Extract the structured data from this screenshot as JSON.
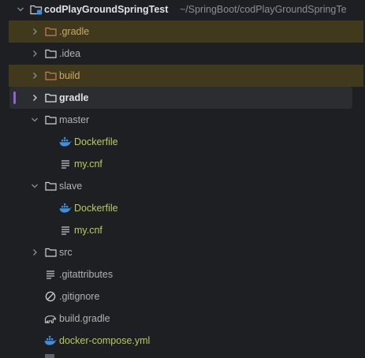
{
  "project": {
    "name": "codPlayGroundSpringTest",
    "path": "~/SpringBoot/codPlayGroundSpringTe"
  },
  "items": [
    {
      "label": ".gradle",
      "type": "folder",
      "expanded": false,
      "state": "excluded"
    },
    {
      "label": ".idea",
      "type": "folder",
      "expanded": false,
      "state": "normal"
    },
    {
      "label": "build",
      "type": "folder",
      "expanded": false,
      "state": "excluded"
    },
    {
      "label": "gradle",
      "type": "folder",
      "expanded": false,
      "state": "selected"
    },
    {
      "label": "master",
      "type": "folder",
      "expanded": true,
      "state": "normal"
    },
    {
      "label": "Dockerfile",
      "type": "docker-file",
      "parent": "master"
    },
    {
      "label": "my.cnf",
      "type": "text-file",
      "parent": "master"
    },
    {
      "label": "slave",
      "type": "folder",
      "expanded": true,
      "state": "normal"
    },
    {
      "label": "Dockerfile",
      "type": "docker-file",
      "parent": "slave"
    },
    {
      "label": "my.cnf",
      "type": "text-file",
      "parent": "slave"
    },
    {
      "label": "src",
      "type": "folder",
      "expanded": false,
      "state": "normal"
    },
    {
      "label": ".gitattributes",
      "type": "text-file"
    },
    {
      "label": ".gitignore",
      "type": "ignore-file"
    },
    {
      "label": "build.gradle",
      "type": "gradle-file"
    },
    {
      "label": "docker-compose.yml",
      "type": "docker-file"
    }
  ],
  "colors": {
    "background": "#1e1f22",
    "excluded_row": "#41391b",
    "selected_row": "#2b2d30",
    "selection_marker": "#8c63d8",
    "modified_text": "#b4cc5e",
    "docker_icon": "#3d8fe0"
  }
}
